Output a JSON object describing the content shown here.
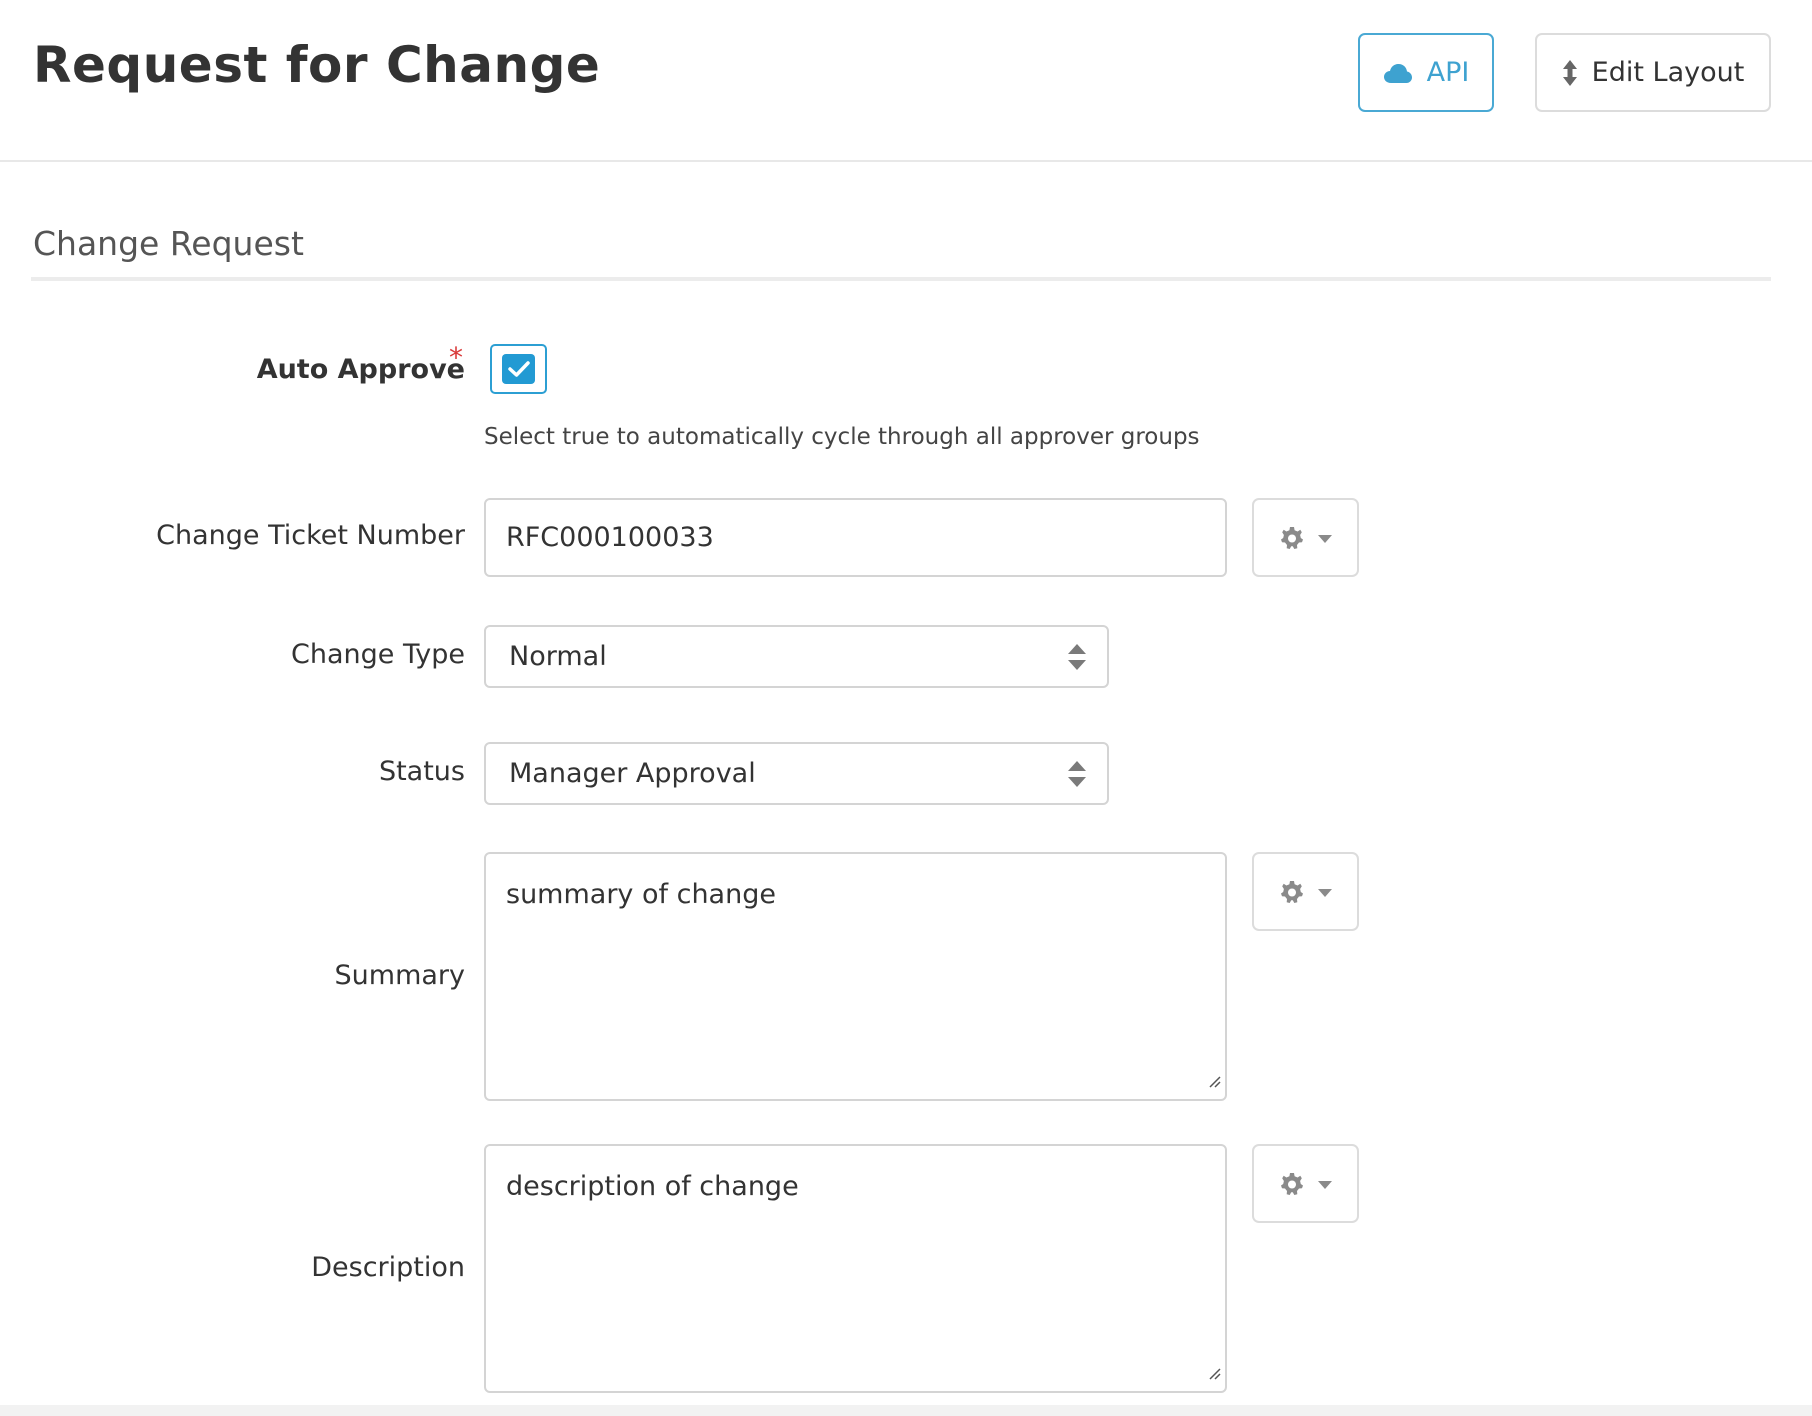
{
  "header": {
    "title": "Request for Change",
    "api_label": "API",
    "edit_layout_label": "Edit Layout"
  },
  "section": {
    "title": "Change Request"
  },
  "form": {
    "auto_approve": {
      "label": "Auto Approve",
      "required_mark": "*",
      "checked": true,
      "help": "Select true to automatically cycle through all approver groups"
    },
    "ticket_number": {
      "label": "Change Ticket Number",
      "value": "RFC000100033"
    },
    "change_type": {
      "label": "Change Type",
      "value": "Normal"
    },
    "status": {
      "label": "Status",
      "value": "Manager Approval"
    },
    "summary": {
      "label": "Summary",
      "value": "summary of change"
    },
    "description": {
      "label": "Description",
      "value": "description of change"
    }
  },
  "colors": {
    "accent": "#2c9fd3",
    "required": "#d93b3b",
    "border": "#d4d4d4"
  },
  "icons": {
    "api": "cloud-icon",
    "edit_layout": "updown-arrows-icon",
    "settings": "gear-icon",
    "dropdown": "caret-down-icon",
    "select": "select-arrows-icon",
    "check": "check-icon"
  }
}
